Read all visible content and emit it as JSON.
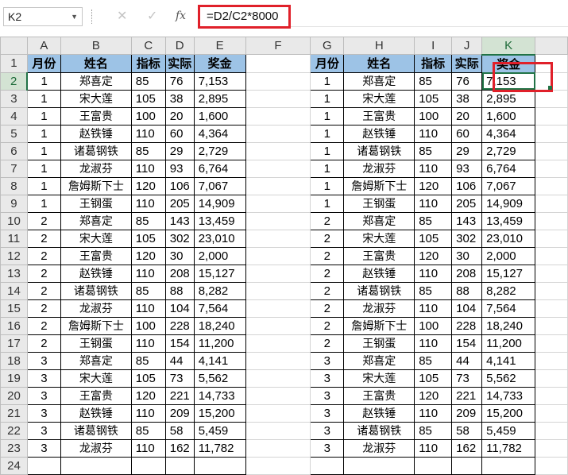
{
  "formula_bar": {
    "name_box": "K2",
    "cancel_icon": "✕",
    "enter_icon": "✓",
    "fx_label": "fx",
    "formula": "=D2/C2*8000"
  },
  "columns": [
    "A",
    "B",
    "C",
    "D",
    "E",
    "F",
    "G",
    "H",
    "I",
    "J",
    "K"
  ],
  "selected_cell": "K2",
  "headers": [
    "月份",
    "姓名",
    "指标",
    "实际",
    "奖金"
  ],
  "rows": [
    {
      "n": "1",
      "m": "1",
      "name": "郑喜定",
      "target": "85",
      "actual": "76",
      "bonus": "7,153"
    },
    {
      "n": "2",
      "m": "1",
      "name": "宋大莲",
      "target": "105",
      "actual": "38",
      "bonus": "2,895"
    },
    {
      "n": "3",
      "m": "1",
      "name": "王富贵",
      "target": "100",
      "actual": "20",
      "bonus": "1,600"
    },
    {
      "n": "4",
      "m": "1",
      "name": "赵铁锤",
      "target": "110",
      "actual": "60",
      "bonus": "4,364"
    },
    {
      "n": "5",
      "m": "1",
      "name": "诸葛钢铁",
      "target": "85",
      "actual": "29",
      "bonus": "2,729"
    },
    {
      "n": "6",
      "m": "1",
      "name": "龙淑芬",
      "target": "110",
      "actual": "93",
      "bonus": "6,764"
    },
    {
      "n": "7",
      "m": "1",
      "name": "詹姆斯下士",
      "target": "120",
      "actual": "106",
      "bonus": "7,067"
    },
    {
      "n": "8",
      "m": "1",
      "name": "王钢蛋",
      "target": "110",
      "actual": "205",
      "bonus": "14,909"
    },
    {
      "n": "9",
      "m": "2",
      "name": "郑喜定",
      "target": "85",
      "actual": "143",
      "bonus": "13,459"
    },
    {
      "n": "10",
      "m": "2",
      "name": "宋大莲",
      "target": "105",
      "actual": "302",
      "bonus": "23,010"
    },
    {
      "n": "11",
      "m": "2",
      "name": "王富贵",
      "target": "120",
      "actual": "30",
      "bonus": "2,000"
    },
    {
      "n": "12",
      "m": "2",
      "name": "赵铁锤",
      "target": "110",
      "actual": "208",
      "bonus": "15,127"
    },
    {
      "n": "13",
      "m": "2",
      "name": "诸葛钢铁",
      "target": "85",
      "actual": "88",
      "bonus": "8,282"
    },
    {
      "n": "14",
      "m": "2",
      "name": "龙淑芬",
      "target": "110",
      "actual": "104",
      "bonus": "7,564"
    },
    {
      "n": "15",
      "m": "2",
      "name": "詹姆斯下士",
      "target": "100",
      "actual": "228",
      "bonus": "18,240"
    },
    {
      "n": "16",
      "m": "2",
      "name": "王钢蛋",
      "target": "110",
      "actual": "154",
      "bonus": "11,200"
    },
    {
      "n": "17",
      "m": "3",
      "name": "郑喜定",
      "target": "85",
      "actual": "44",
      "bonus": "4,141"
    },
    {
      "n": "18",
      "m": "3",
      "name": "宋大莲",
      "target": "105",
      "actual": "73",
      "bonus": "5,562"
    },
    {
      "n": "19",
      "m": "3",
      "name": "王富贵",
      "target": "120",
      "actual": "221",
      "bonus": "14,733"
    },
    {
      "n": "20",
      "m": "3",
      "name": "赵铁锤",
      "target": "110",
      "actual": "209",
      "bonus": "15,200"
    },
    {
      "n": "21",
      "m": "3",
      "name": "诸葛钢铁",
      "target": "85",
      "actual": "58",
      "bonus": "5,459"
    },
    {
      "n": "22",
      "m": "3",
      "name": "龙淑芬",
      "target": "110",
      "actual": "162",
      "bonus": "11,782"
    }
  ],
  "colors": {
    "header_fill": "#9dc3e6",
    "selection": "#217346",
    "highlight": "#e0202a"
  }
}
